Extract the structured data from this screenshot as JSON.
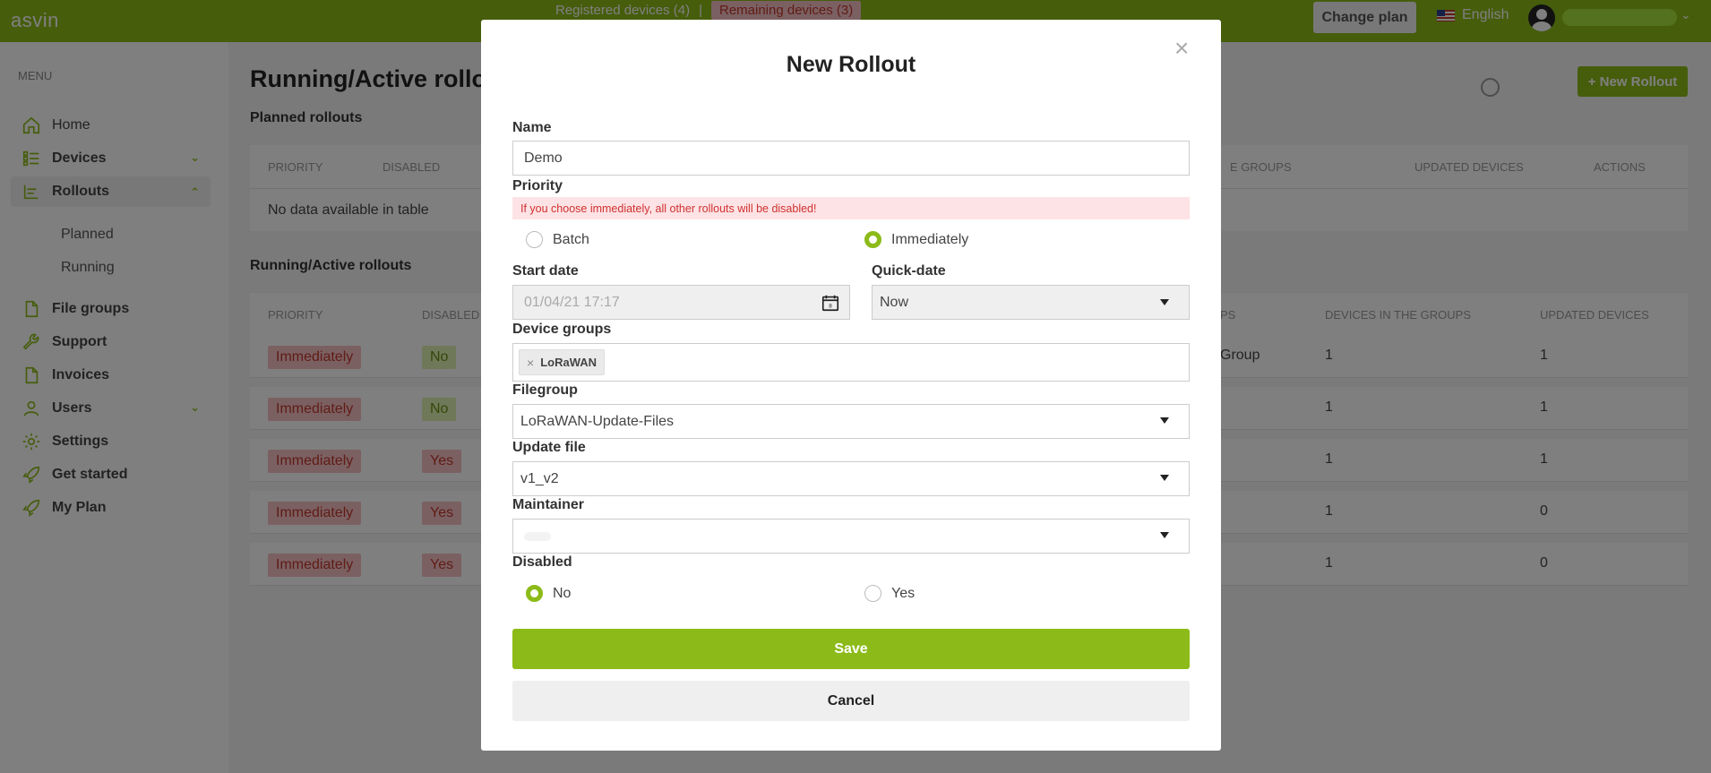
{
  "header": {
    "brand": "asvin",
    "registered_devices": "Registered devices (4)",
    "separator": "|",
    "remaining_devices": "Remaining devices (3)",
    "change_plan": "Change plan",
    "language": "English"
  },
  "sidebar": {
    "menu_label": "MENU",
    "items": [
      {
        "label": "Home",
        "icon": "home-icon"
      },
      {
        "label": "Devices",
        "icon": "devices-icon"
      },
      {
        "label": "Rollouts",
        "icon": "rollouts-icon"
      },
      {
        "label": "File groups",
        "icon": "file-icon"
      },
      {
        "label": "Support",
        "icon": "wrench-icon"
      },
      {
        "label": "Invoices",
        "icon": "file-icon"
      },
      {
        "label": "Users",
        "icon": "user-icon"
      },
      {
        "label": "Settings",
        "icon": "gear-icon"
      },
      {
        "label": "Get started",
        "icon": "rocket-icon"
      },
      {
        "label": "My Plan",
        "icon": "rocket-icon"
      }
    ],
    "sub_items": [
      "Planned",
      "Running"
    ]
  },
  "main": {
    "page_title": "Running/Active rollouts",
    "new_rollout_button": "+ New Rollout",
    "planned": {
      "title": "Planned rollouts",
      "headers": [
        "PRIORITY",
        "DISABLED",
        "E GROUPS",
        "UPDATED DEVICES",
        "ACTIONS"
      ],
      "empty": "No data available in table"
    },
    "running": {
      "title": "Running/Active rollouts",
      "headers": [
        "PRIORITY",
        "DISABLED",
        "PS",
        "DEVICES IN THE GROUPS",
        "UPDATED DEVICES"
      ],
      "rows": [
        {
          "priority": "Immediately",
          "disabled": "No",
          "group": "Group",
          "devices": "1",
          "updated": "1"
        },
        {
          "priority": "Immediately",
          "disabled": "No",
          "group": "",
          "devices": "1",
          "updated": "1"
        },
        {
          "priority": "Immediately",
          "disabled": "Yes",
          "group": "",
          "devices": "1",
          "updated": "1"
        },
        {
          "priority": "Immediately",
          "disabled": "Yes",
          "group": "",
          "devices": "1",
          "updated": "0"
        },
        {
          "priority": "Immediately",
          "disabled": "Yes",
          "group": "",
          "devices": "1",
          "updated": "0"
        }
      ]
    }
  },
  "modal": {
    "title": "New Rollout",
    "close": "×",
    "name_label": "Name",
    "name_value": "Demo",
    "priority_label": "Priority",
    "priority_warning": "If you choose immediately, all other rollouts will be disabled!",
    "priority_options": [
      "Batch",
      "Immediately"
    ],
    "priority_selected": "Immediately",
    "start_date_label": "Start date",
    "start_date_value": "01/04/21 17:17",
    "quick_date_label": "Quick-date",
    "quick_date_value": "Now",
    "device_groups_label": "Device groups",
    "device_group_tag": "LoRaWAN",
    "filegroup_label": "Filegroup",
    "filegroup_value": "LoRaWAN-Update-Files",
    "update_file_label": "Update file",
    "update_file_value": "v1_v2",
    "maintainer_label": "Maintainer",
    "maintainer_value": "",
    "disabled_label": "Disabled",
    "disabled_options": [
      "No",
      "Yes"
    ],
    "disabled_selected": "No",
    "save": "Save",
    "cancel": "Cancel"
  },
  "colors": {
    "accent": "#8cbb19",
    "danger_bg": "#f7c0c4",
    "danger_text": "#c0392b"
  }
}
